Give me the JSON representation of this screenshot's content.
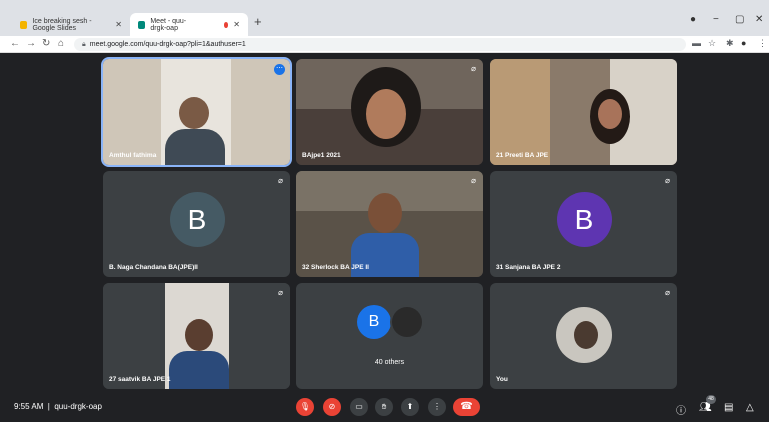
{
  "tabs": [
    {
      "title": "Ice breaking sesh - Google Slides",
      "color": "#f4b400"
    },
    {
      "title": "Meet - quu-drgk-oap",
      "color": "#00897b"
    }
  ],
  "address": "meet.google.com/quu-drgk-oap?pli=1&authuser=1",
  "participants": [
    {
      "name": "Amthul fathima",
      "bg": "#cfc6b8"
    },
    {
      "name": "BAjpe1 2021",
      "bg": "#4a3f3a"
    },
    {
      "name": "21 Preeti BA JPE",
      "bg": "#8a7a6a"
    },
    {
      "name": "B. Naga Chandana BA(JPE)II",
      "initial": "B",
      "avatar_color": "#455a64"
    },
    {
      "name": "32 Sherlock BA JPE II",
      "bg": "#5a5248"
    },
    {
      "name": "31 Sanjana BA JPE 2",
      "initial": "B",
      "avatar_color": "#5e35b1"
    },
    {
      "name": "27 saatvik BA JPE 1",
      "bg": "#6b6b6b"
    },
    {
      "name": "40 others",
      "initial": "B",
      "avatar_color": "#1a73e8"
    },
    {
      "name": "You",
      "bg": "#c9c6bf"
    }
  ],
  "meeting": {
    "time": "9:55 AM",
    "code": "quu-drgk-oap",
    "participant_count": "48"
  }
}
